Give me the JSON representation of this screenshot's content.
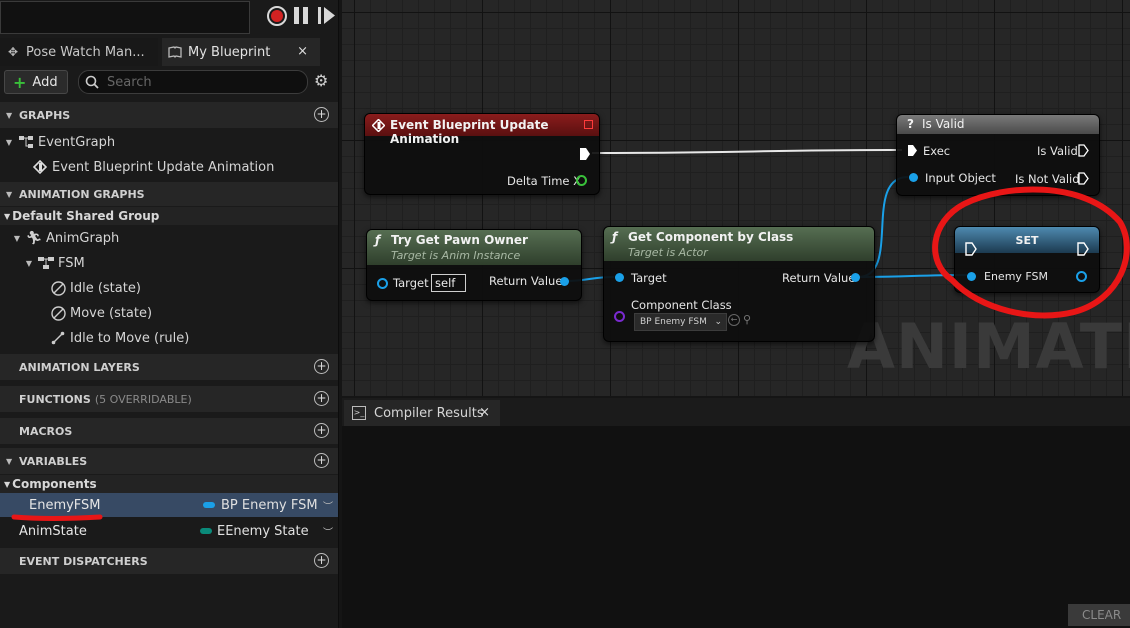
{
  "left_panel": {
    "tabs": [
      {
        "label": "Pose Watch Man..."
      },
      {
        "label": "My Blueprint",
        "close": "×"
      }
    ],
    "add_label": "Add",
    "search_placeholder": "Search",
    "sections": {
      "graphs": "GRAPHS",
      "animation_graphs": "ANIMATION GRAPHS",
      "animation_layers": "ANIMATION LAYERS",
      "functions": "FUNCTIONS",
      "functions_sub": "(5 OVERRIDABLE)",
      "macros": "MACROS",
      "variables": "VARIABLES",
      "event_dispatchers": "EVENT DISPATCHERS"
    },
    "graph_items": {
      "event_graph": "EventGraph",
      "event_bp_update": "Event Blueprint Update Animation"
    },
    "anim_items": {
      "default_shared_group": "Default Shared Group",
      "anim_graph": "AnimGraph",
      "fsm": "FSM",
      "idle_state": "Idle (state)",
      "move_state": "Move (state)",
      "idle_to_move": "Idle to Move (rule)"
    },
    "variables": {
      "category": "Components",
      "items": [
        {
          "name": "EnemyFSM",
          "type": "BP Enemy FSM",
          "type_color": "#1aa0e8",
          "selected": true
        },
        {
          "name": "AnimState",
          "type": "EEnemy State",
          "type_color": "#0a8a7a",
          "selected": false
        }
      ]
    }
  },
  "graph": {
    "watermark": "ANIMATION",
    "nodes": {
      "event_update": {
        "title": "Event Blueprint Update Animation",
        "pin_delta": "Delta Time X",
        "color": "#7a1515"
      },
      "try_get_pawn": {
        "title": "Try Get Pawn Owner",
        "subtitle": "Target is Anim Instance",
        "pin_target": "Target",
        "self_value": "self",
        "pin_return": "Return Value",
        "color": "#4a6a48"
      },
      "get_component": {
        "title": "Get Component by Class",
        "subtitle": "Target is Actor",
        "pin_target": "Target",
        "pin_return": "Return Value",
        "pin_class": "Component Class",
        "class_value": "BP Enemy FSM",
        "color": "#4a6a48"
      },
      "is_valid": {
        "title": "Is Valid",
        "pin_exec": "Exec",
        "pin_input": "Input Object",
        "pin_valid": "Is Valid",
        "pin_not_valid": "Is Not Valid",
        "color": "#6a6a6a"
      },
      "set_node": {
        "title": "SET",
        "pin_enemy": "Enemy FSM",
        "color": "#3a6a8a"
      }
    }
  },
  "compiler": {
    "tab_label": "Compiler Results",
    "close": "×",
    "clear_label": "CLEAR"
  },
  "annotation_color": "#e81616"
}
